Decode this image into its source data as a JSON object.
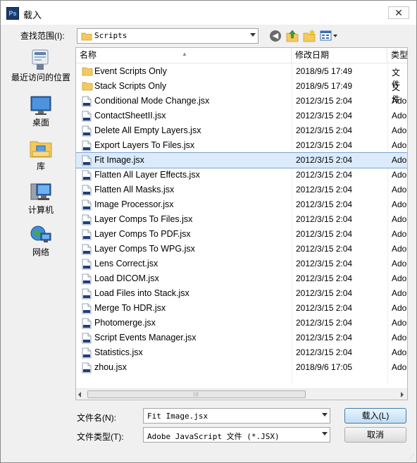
{
  "window": {
    "title": "载入",
    "app_icon": "Ps"
  },
  "lookin": {
    "label": "查找范围(I):",
    "value": "Scripts"
  },
  "places": [
    "最近访问的位置",
    "桌面",
    "库",
    "计算机",
    "网络"
  ],
  "columns": {
    "name": "名称",
    "modified": "修改日期",
    "type": "类型"
  },
  "files": [
    {
      "name": "Event Scripts Only",
      "date": "2018/9/5 17:49",
      "type": "文件",
      "kind": "folder"
    },
    {
      "name": "Stack Scripts Only",
      "date": "2018/9/5 17:49",
      "type": "文件",
      "kind": "folder"
    },
    {
      "name": "Conditional Mode Change.jsx",
      "date": "2012/3/15 2:04",
      "type": "Ado",
      "kind": "jsx"
    },
    {
      "name": "ContactSheetII.jsx",
      "date": "2012/3/15 2:04",
      "type": "Ado",
      "kind": "jsx"
    },
    {
      "name": "Delete All Empty Layers.jsx",
      "date": "2012/3/15 2:04",
      "type": "Ado",
      "kind": "jsx"
    },
    {
      "name": "Export Layers To Files.jsx",
      "date": "2012/3/15 2:04",
      "type": "Ado",
      "kind": "jsx"
    },
    {
      "name": "Fit Image.jsx",
      "date": "2012/3/15 2:04",
      "type": "Ado",
      "kind": "jsx",
      "selected": true
    },
    {
      "name": "Flatten All Layer Effects.jsx",
      "date": "2012/3/15 2:04",
      "type": "Ado",
      "kind": "jsx"
    },
    {
      "name": "Flatten All Masks.jsx",
      "date": "2012/3/15 2:04",
      "type": "Ado",
      "kind": "jsx"
    },
    {
      "name": "Image Processor.jsx",
      "date": "2012/3/15 2:04",
      "type": "Ado",
      "kind": "jsx"
    },
    {
      "name": "Layer Comps To Files.jsx",
      "date": "2012/3/15 2:04",
      "type": "Ado",
      "kind": "jsx"
    },
    {
      "name": "Layer Comps To PDF.jsx",
      "date": "2012/3/15 2:04",
      "type": "Ado",
      "kind": "jsx"
    },
    {
      "name": "Layer Comps To WPG.jsx",
      "date": "2012/3/15 2:04",
      "type": "Ado",
      "kind": "jsx"
    },
    {
      "name": "Lens Correct.jsx",
      "date": "2012/3/15 2:04",
      "type": "Ado",
      "kind": "jsx"
    },
    {
      "name": "Load DICOM.jsx",
      "date": "2012/3/15 2:04",
      "type": "Ado",
      "kind": "jsx"
    },
    {
      "name": "Load Files into Stack.jsx",
      "date": "2012/3/15 2:04",
      "type": "Ado",
      "kind": "jsx"
    },
    {
      "name": "Merge To HDR.jsx",
      "date": "2012/3/15 2:04",
      "type": "Ado",
      "kind": "jsx"
    },
    {
      "name": "Photomerge.jsx",
      "date": "2012/3/15 2:04",
      "type": "Ado",
      "kind": "jsx"
    },
    {
      "name": "Script Events Manager.jsx",
      "date": "2012/3/15 2:04",
      "type": "Ado",
      "kind": "jsx"
    },
    {
      "name": "Statistics.jsx",
      "date": "2012/3/15 2:04",
      "type": "Ado",
      "kind": "jsx"
    },
    {
      "name": "zhou.jsx",
      "date": "2018/9/6 17:05",
      "type": "Ado",
      "kind": "jsx"
    }
  ],
  "filename": {
    "label": "文件名(N):",
    "value": "Fit Image.jsx"
  },
  "filetype": {
    "label": "文件类型(T):",
    "value": "Adobe JavaScript 文件 (*.JSX)"
  },
  "buttons": {
    "open": "载入(L)",
    "cancel": "取消"
  },
  "close_symbol": "✕",
  "colors": {
    "selection": "#dcebfc",
    "selection_border": "#7da2ce",
    "folder": "#f4c95d"
  }
}
